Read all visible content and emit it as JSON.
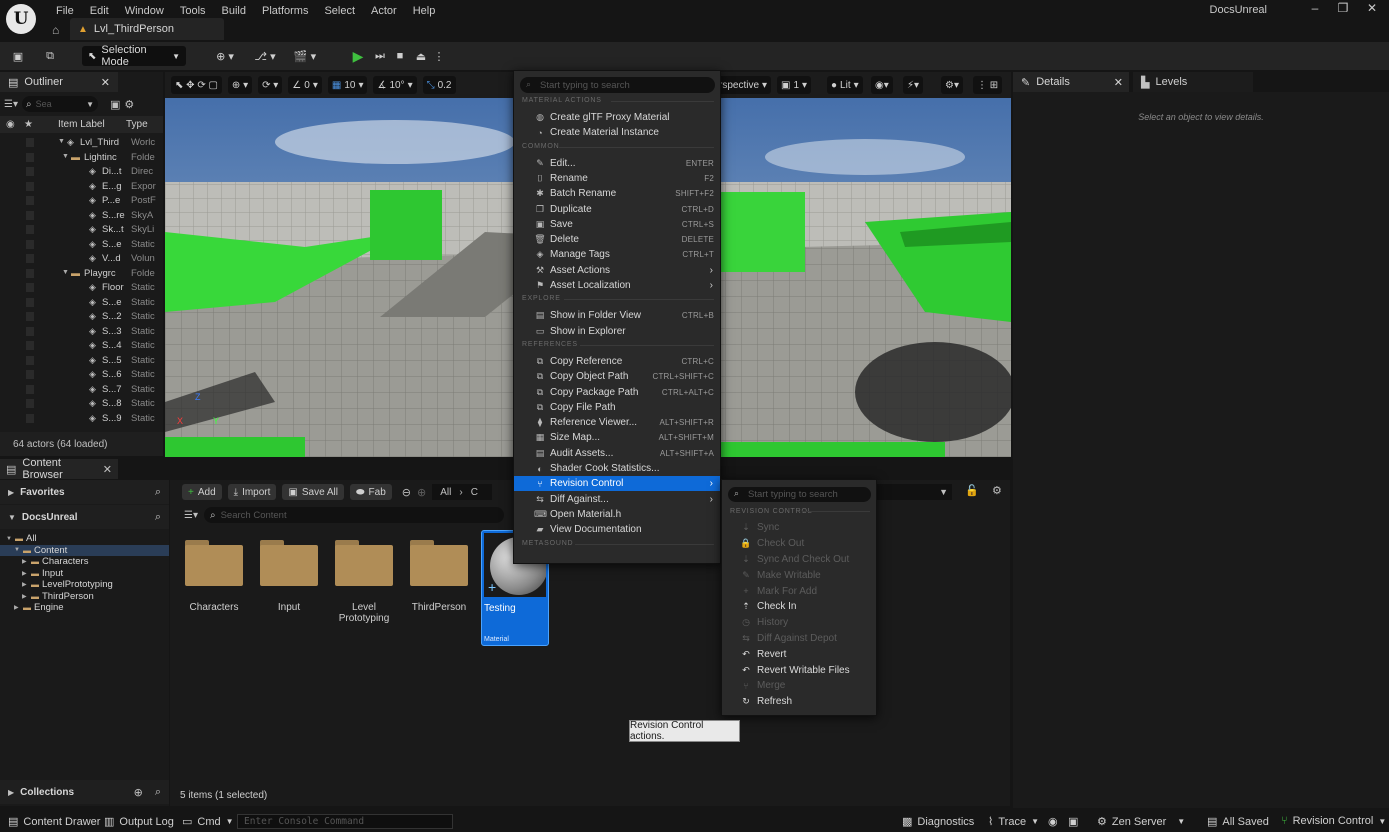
{
  "app": {
    "logo": "U",
    "menu": [
      "File",
      "Edit",
      "Window",
      "Tools",
      "Build",
      "Platforms",
      "Select",
      "Actor",
      "Help"
    ],
    "project_name": "DocsUnreal",
    "window_controls": [
      "–",
      "❐",
      "✕"
    ],
    "level_tab": "Lvl_ThirdPerson"
  },
  "toolbar": {
    "selection_mode": "Selection Mode",
    "play_color": "#3fbf3f"
  },
  "outliner": {
    "tab_title": "Outliner",
    "search_placeholder": "Sea",
    "col_label": "Item Label",
    "col_type": "Type",
    "rows": [
      {
        "label": "Lvl_Third",
        "type": "Worlc",
        "indent": 1
      },
      {
        "label": "Lightinc",
        "type": "Folde",
        "indent": 2
      },
      {
        "label": "Di...t",
        "type": "Direc",
        "indent": 3
      },
      {
        "label": "E...g",
        "type": "Expor",
        "indent": 3
      },
      {
        "label": "P...e",
        "type": "PostF",
        "indent": 3
      },
      {
        "label": "S...re",
        "type": "SkyA",
        "indent": 3
      },
      {
        "label": "Sk...t",
        "type": "SkyLi",
        "indent": 3
      },
      {
        "label": "S...e",
        "type": "Static",
        "indent": 3
      },
      {
        "label": "V...d",
        "type": "Volun",
        "indent": 3
      },
      {
        "label": "Playgrc",
        "type": "Folde",
        "indent": 2
      },
      {
        "label": "Floor",
        "type": "Static",
        "indent": 3
      },
      {
        "label": "S...e",
        "type": "Static",
        "indent": 3
      },
      {
        "label": "S...2",
        "type": "Static",
        "indent": 3
      },
      {
        "label": "S...3",
        "type": "Static",
        "indent": 3
      },
      {
        "label": "S...4",
        "type": "Static",
        "indent": 3
      },
      {
        "label": "S...5",
        "type": "Static",
        "indent": 3
      },
      {
        "label": "S...6",
        "type": "Static",
        "indent": 3
      },
      {
        "label": "S...7",
        "type": "Static",
        "indent": 3
      },
      {
        "label": "S...8",
        "type": "Static",
        "indent": 3
      },
      {
        "label": "S...9",
        "type": "Static",
        "indent": 3
      }
    ],
    "footer": "64 actors (64 loaded)"
  },
  "viewport": {
    "perspective": "rspective",
    "lit": "Lit",
    "snap_rotation": "0",
    "grid": "10",
    "angle": "10°",
    "scale": "0.2",
    "camera_speed": "1"
  },
  "details": {
    "tab_details": "Details",
    "tab_levels": "Levels",
    "empty_hint": "Select an object to view details."
  },
  "content_browser": {
    "tab_title": "Content Browser",
    "favorites": "Favorites",
    "project": "DocsUnreal",
    "tree": [
      {
        "label": "All",
        "level": 0
      },
      {
        "label": "Content",
        "level": 1
      },
      {
        "label": "Characters",
        "level": 2
      },
      {
        "label": "Input",
        "level": 2
      },
      {
        "label": "LevelPrototyping",
        "level": 2
      },
      {
        "label": "ThirdPerson",
        "level": 2
      },
      {
        "label": "Engine",
        "level": 1
      }
    ],
    "collections": "Collections",
    "add_label": "Add",
    "import_label": "Import",
    "save_all_label": "Save All",
    "fab_label": "Fab",
    "path_all": "All",
    "path_next": "C",
    "search_placeholder": "Search Content",
    "assets": [
      {
        "label": "Characters"
      },
      {
        "label": "Input"
      },
      {
        "label": "Level Prototyping"
      },
      {
        "label": "ThirdPerson"
      }
    ],
    "selected_asset": {
      "label": "Testing",
      "type": "Material"
    },
    "status": "5 items (1 selected)"
  },
  "context_menu": {
    "search_placeholder": "Start typing to search",
    "sections": [
      {
        "title": "MATERIAL ACTIONS",
        "items": [
          {
            "label": "Create glTF Proxy Material",
            "shortcut": "",
            "icon": "◍",
            "arrow": false
          },
          {
            "label": "Create Material Instance",
            "shortcut": "",
            "icon": "◔",
            "arrow": false
          }
        ]
      },
      {
        "title": "COMMON",
        "items": [
          {
            "label": "Edit...",
            "shortcut": "ENTER",
            "icon": "✎",
            "arrow": false
          },
          {
            "label": "Rename",
            "shortcut": "F2",
            "icon": "⌷",
            "arrow": false
          },
          {
            "label": "Batch Rename",
            "shortcut": "SHIFT+F2",
            "icon": "✱",
            "arrow": false
          },
          {
            "label": "Duplicate",
            "shortcut": "CTRL+D",
            "icon": "❐",
            "arrow": false
          },
          {
            "label": "Save",
            "shortcut": "CTRL+S",
            "icon": "▣",
            "arrow": false
          },
          {
            "label": "Delete",
            "shortcut": "DELETE",
            "icon": "🗑",
            "arrow": false
          },
          {
            "label": "Manage Tags",
            "shortcut": "CTRL+T",
            "icon": "◈",
            "arrow": false
          },
          {
            "label": "Asset Actions",
            "shortcut": "",
            "icon": "⚒",
            "arrow": true
          },
          {
            "label": "Asset Localization",
            "shortcut": "",
            "icon": "⚑",
            "arrow": true
          }
        ]
      },
      {
        "title": "EXPLORE",
        "items": [
          {
            "label": "Show in Folder View",
            "shortcut": "CTRL+B",
            "icon": "▤",
            "arrow": false
          },
          {
            "label": "Show in Explorer",
            "shortcut": "",
            "icon": "▭",
            "arrow": false
          }
        ]
      },
      {
        "title": "REFERENCES",
        "items": [
          {
            "label": "Copy Reference",
            "shortcut": "CTRL+C",
            "icon": "⧉",
            "arrow": false
          },
          {
            "label": "Copy Object Path",
            "shortcut": "CTRL+SHIFT+C",
            "icon": "⧉",
            "arrow": false
          },
          {
            "label": "Copy Package Path",
            "shortcut": "CTRL+ALT+C",
            "icon": "⧉",
            "arrow": false
          },
          {
            "label": "Copy File Path",
            "shortcut": "",
            "icon": "⧉",
            "arrow": false
          },
          {
            "label": "Reference Viewer...",
            "shortcut": "ALT+SHIFT+R",
            "icon": "⧫",
            "arrow": false
          },
          {
            "label": "Size Map...",
            "shortcut": "ALT+SHIFT+M",
            "icon": "▦",
            "arrow": false
          },
          {
            "label": "Audit Assets...",
            "shortcut": "ALT+SHIFT+A",
            "icon": "▤",
            "arrow": false
          },
          {
            "label": "Shader Cook Statistics...",
            "shortcut": "",
            "icon": "◐",
            "arrow": false
          },
          {
            "label": "Revision Control",
            "shortcut": "",
            "icon": "⑂",
            "arrow": true,
            "highlight": true
          },
          {
            "label": "Diff Against...",
            "shortcut": "",
            "icon": "⇆",
            "arrow": true
          },
          {
            "label": "Open Material.h",
            "shortcut": "",
            "icon": "⌨",
            "arrow": false
          },
          {
            "label": "View Documentation",
            "shortcut": "",
            "icon": "▰",
            "arrow": false
          }
        ]
      },
      {
        "title": "METASOUND",
        "items": []
      }
    ]
  },
  "revision_submenu": {
    "search_placeholder": "Start typing to search",
    "section": "REVISION CONTROL",
    "items": [
      {
        "label": "Sync",
        "enabled": false,
        "icon": "⇣"
      },
      {
        "label": "Check Out",
        "enabled": false,
        "icon": "🔒"
      },
      {
        "label": "Sync And Check Out",
        "enabled": false,
        "icon": "⇣"
      },
      {
        "label": "Make Writable",
        "enabled": false,
        "icon": "✎"
      },
      {
        "label": "Mark For Add",
        "enabled": false,
        "icon": "+"
      },
      {
        "label": "Check In",
        "enabled": true,
        "icon": "⇡"
      },
      {
        "label": "History",
        "enabled": false,
        "icon": "◷"
      },
      {
        "label": "Diff Against Depot",
        "enabled": false,
        "icon": "⇆"
      },
      {
        "label": "Revert",
        "enabled": true,
        "icon": "↶"
      },
      {
        "label": "Revert Writable Files",
        "enabled": true,
        "icon": "↶"
      },
      {
        "label": "Merge",
        "enabled": false,
        "icon": "⑂"
      },
      {
        "label": "Refresh",
        "enabled": true,
        "icon": "↻"
      }
    ]
  },
  "tooltip": "Revision Control actions.",
  "statusbar": {
    "content_drawer": "Content Drawer",
    "output_log": "Output Log",
    "cmd": "Cmd",
    "console_placeholder": "Enter Console Command",
    "diagnostics": "Diagnostics",
    "trace": "Trace",
    "zen_server": "Zen Server",
    "all_saved": "All Saved",
    "revision_control": "Revision Control"
  }
}
